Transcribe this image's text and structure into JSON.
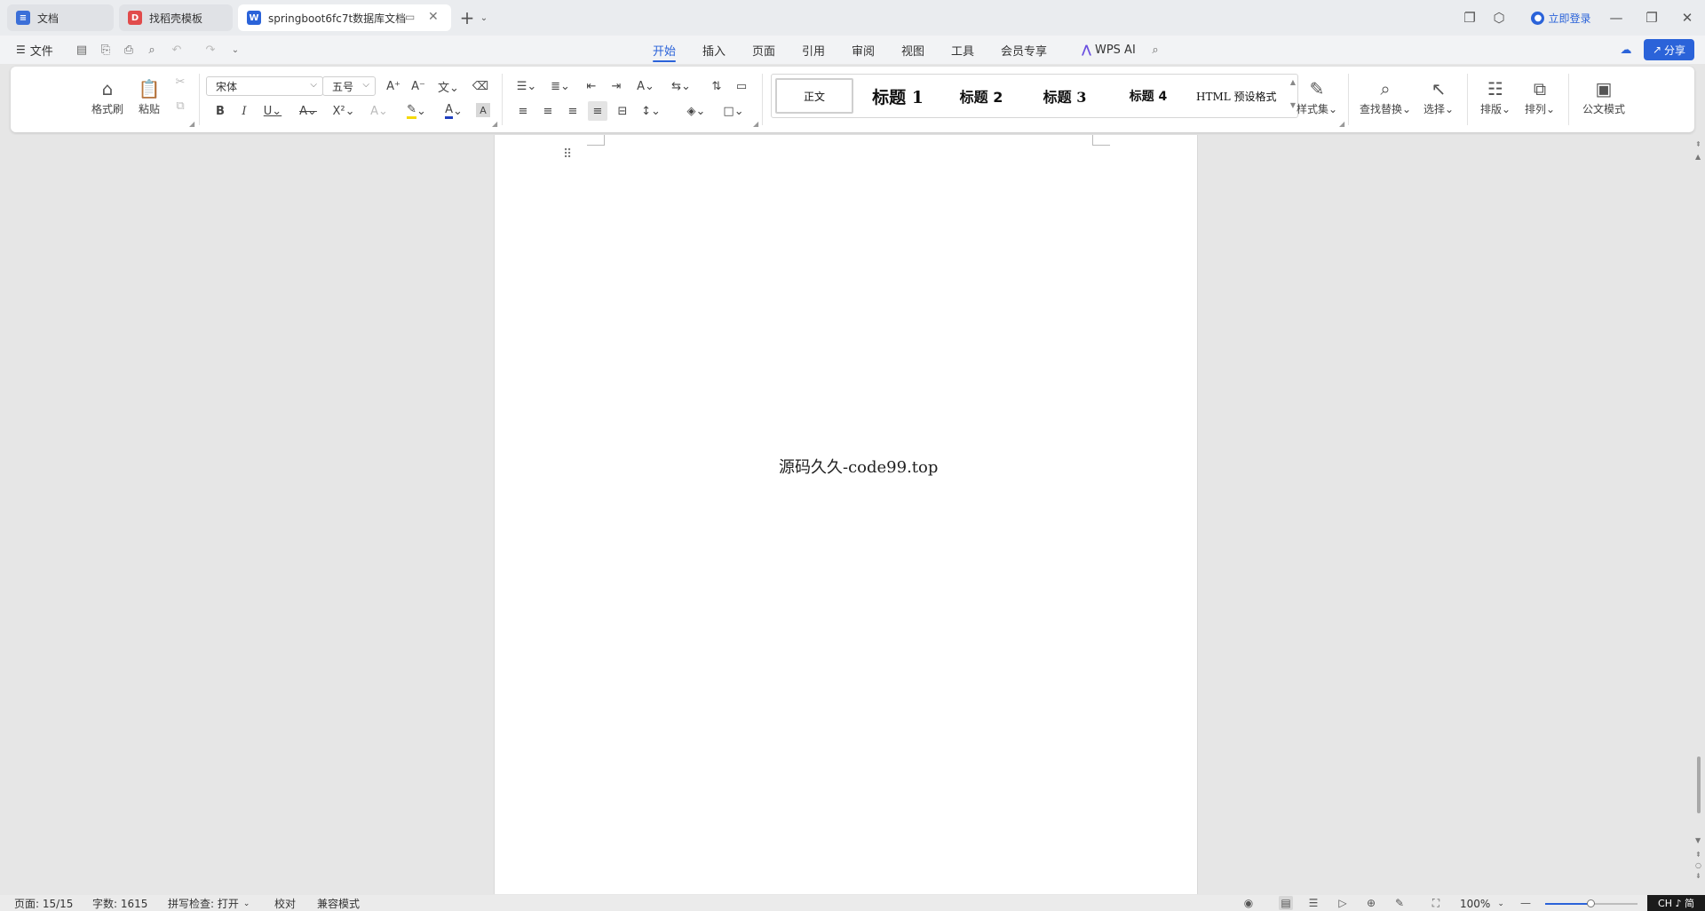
{
  "titlebar": {
    "tabs": [
      {
        "label": "文档",
        "icon": "wps-docs-icon",
        "color": "#3b6fd8"
      },
      {
        "label": "找稻壳模板",
        "icon": "docer-icon",
        "color": "#e14b4b"
      },
      {
        "label": "springboot6fc7t数据库文档",
        "icon": "word-doc-icon",
        "color": "#2b63d9"
      }
    ],
    "login_label": "立即登录"
  },
  "menubar": {
    "file_label": "文件",
    "tabs": [
      "开始",
      "插入",
      "页面",
      "引用",
      "审阅",
      "视图",
      "工具",
      "会员专享"
    ],
    "active_tab": "开始",
    "wps_ai_label": "WPS AI",
    "share_label": "分享"
  },
  "ribbon": {
    "format_painter_label": "格式刷",
    "paste_label": "粘贴",
    "font_name": "宋体",
    "font_size": "五号",
    "styles": [
      "正文",
      "标题 1",
      "标题 2",
      "标题 3",
      "标题 4",
      "HTML 预设格式"
    ],
    "style_set_label": "样式集",
    "find_replace_label": "查找替换",
    "select_label": "选择",
    "layout_label": "排版",
    "arrange_label": "排列",
    "official_mode_label": "公文模式"
  },
  "document": {
    "body_text": "源码久久-code99.top"
  },
  "statusbar": {
    "page": "页面: 15/15",
    "word_count": "字数: 1615",
    "spell_check": "拼写检查: 打开",
    "proofread": "校对",
    "compat_mode": "兼容模式",
    "zoom": "100%",
    "zoom_fraction": 0.5,
    "ime": "CH ♪ 简"
  },
  "colors": {
    "accent": "#2b63d9",
    "highlight_yellow": "#f5d90a",
    "font_color_blue": "#1f3fbf"
  }
}
